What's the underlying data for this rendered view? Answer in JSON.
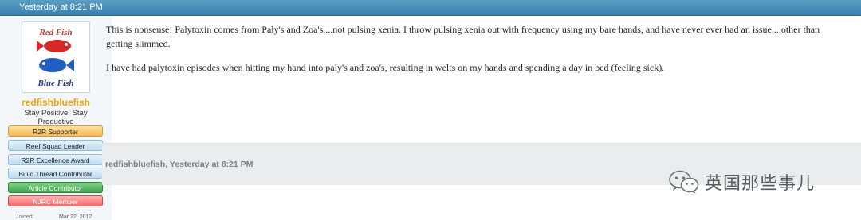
{
  "post": {
    "date": "Yesterday at 8:21 PM",
    "body": [
      "This is nonsense! Palytoxin comes from Paly's and Zoa's....not pulsing xenia. I throw pulsing xenia out with frequency using my bare hands, and have never ever had an issue....other than getting slimmed.",
      "I have had palytoxin episodes when hitting my hand into paly's and zoa's, resulting in welts on my hands and spending a day in bed (feeling sick)."
    ],
    "footer_meta": "redfishbluefish, Yesterday at 8:21 PM"
  },
  "user": {
    "avatar_text_top": "Red Fish",
    "avatar_text_bottom": "Blue Fish",
    "username": "redfishbluefish",
    "title": "Stay Positive, Stay Productive",
    "badges": [
      "R2R Supporter",
      "Reef Squad Leader",
      "R2R Excellence Award",
      "Build Thread Contributor",
      "Article Contributor",
      "NJRC Member"
    ],
    "joined_label": "Joined:",
    "joined_value": "Mar 22, 2012"
  },
  "watermark": {
    "text": "英国那些事儿",
    "icon": "wechat-icon"
  },
  "colors": {
    "header": "#3a7fae",
    "username": "#f2a20a",
    "badge_supporter": "#f7b955",
    "badge_blue": "#bcdaf0",
    "badge_green": "#3ea34a",
    "badge_red": "#f26a6a",
    "footer_bg": "#ebeced"
  }
}
